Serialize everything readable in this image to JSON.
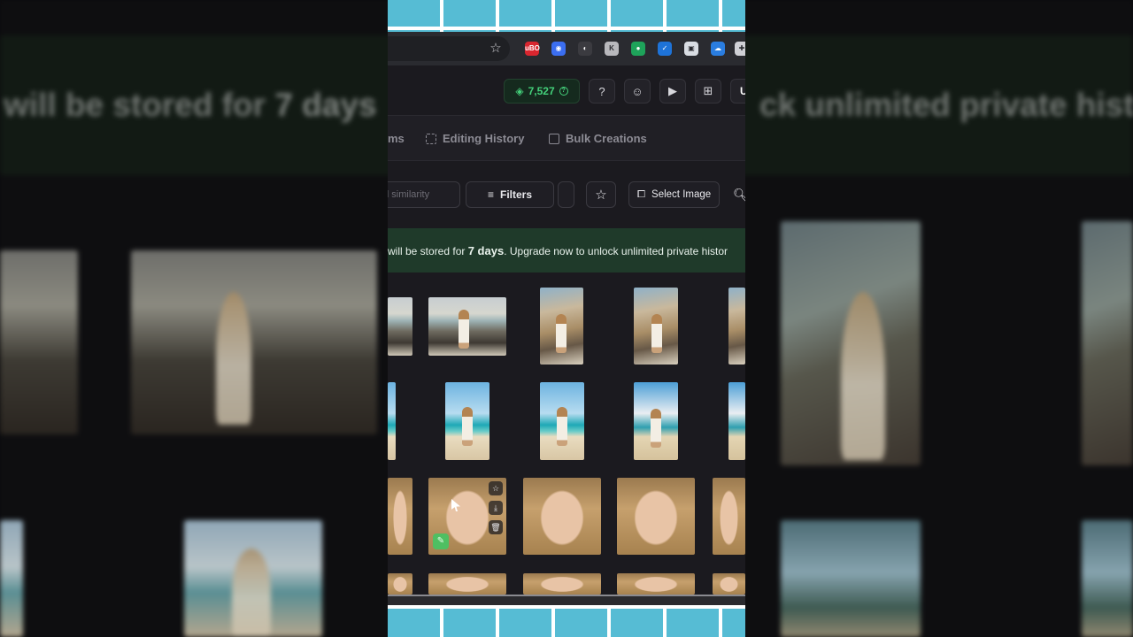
{
  "background": {
    "notice_left": "will be stored for ",
    "notice_left_bold": "7 days",
    "notice_right": "ck unlimited private histor"
  },
  "browser": {
    "extensions": [
      {
        "name": "ublock-icon",
        "label": "uBO",
        "color": "#d9262f"
      },
      {
        "name": "extension-blue-icon",
        "label": "◉",
        "color": "#3b6ef0"
      },
      {
        "name": "extension-dark-icon",
        "label": "◐",
        "color": "#3b3b40"
      },
      {
        "name": "extension-k-icon",
        "label": "K",
        "color": "#b8b8bc"
      },
      {
        "name": "extension-green-icon",
        "label": "●",
        "color": "#1ea35a"
      },
      {
        "name": "extension-check-icon",
        "label": "✓",
        "color": "#1e73d8"
      },
      {
        "name": "extension-square-icon",
        "label": "▣",
        "color": "#d9dde3"
      },
      {
        "name": "extension-cloud-icon",
        "label": "☁",
        "color": "#2a7de0"
      },
      {
        "name": "puzzle-icon",
        "label": "✚",
        "color": "#cfd0d5"
      }
    ]
  },
  "header": {
    "credits": "7,527",
    "buttons": [
      {
        "name": "help-icon",
        "glyph": "?"
      },
      {
        "name": "discord-icon",
        "glyph": "☺"
      },
      {
        "name": "youtube-icon",
        "glyph": "▶"
      },
      {
        "name": "gift-icon",
        "glyph": "⊞"
      }
    ],
    "avatar_letter": "U"
  },
  "tabs": {
    "partial": "ms",
    "editing_history": "Editing History",
    "bulk_creations": "Bulk Creations"
  },
  "toolbar": {
    "search_placeholder": "nd similarity",
    "filters": "Filters",
    "select_image": "Select Image"
  },
  "notice": {
    "prefix": "will be stored for ",
    "days": "7 days",
    "suffix": ". Upgrade now to unlock unlimited private histor"
  }
}
